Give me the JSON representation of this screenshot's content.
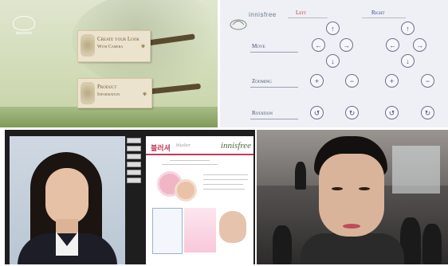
{
  "menu_panel": {
    "logo_text": "innisfree",
    "create_look_label": "Create your Look",
    "create_look_sub": "With Camera",
    "product_info_label": "Product",
    "product_info_sub": "Information"
  },
  "control_panel": {
    "brand": "innisfree",
    "left_header": "Left",
    "right_header": "Right",
    "rows": {
      "move": "Move",
      "zooming": "Zooming",
      "rotation": "Rotation"
    },
    "glyphs": {
      "up": "↑",
      "down": "↓",
      "left": "←",
      "right": "→",
      "plus": "+",
      "minus": "−",
      "ccw": "↺",
      "cw": "↻"
    },
    "colors": {
      "left": "#c0392b",
      "right": "#2c4a8a"
    }
  },
  "app_panel": {
    "doc_title": "블러셔",
    "doc_subtitle": "blusher",
    "doc_brand": "innisfree"
  }
}
